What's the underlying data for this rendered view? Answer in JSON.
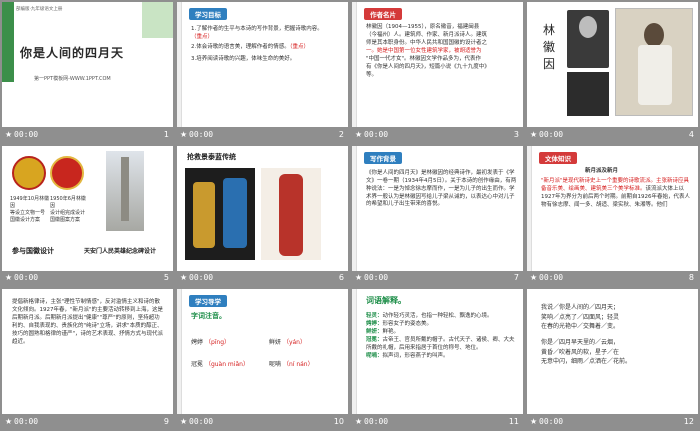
{
  "slides": [
    {
      "number": "1",
      "time": "00:00",
      "series_label": "部编版·九年级语文上册",
      "title": "你是人间的四月天",
      "footer": "第一PPT模板网-WWW.1PPT.COM"
    },
    {
      "number": "2",
      "time": "00:00",
      "heading": "学习目标",
      "items": [
        "1.了解作者的生平与本诗的写作背景，把握诗歌内容。",
        "2.体会诗歌的语言美，理解作者的情感。",
        "3.培养阅读诗歌的兴趣，体味生命的美好。"
      ],
      "highlight_1": "（重点）",
      "highlight_2": "（重点）"
    },
    {
      "number": "3",
      "time": "00:00",
      "heading": "作者名片",
      "lines": [
        "林徽因（1904—1955），原名徽音，福建闽县",
        "（今福州）人。建筑师、作家、新月派诗人。建筑",
        "师是其本职身份。中华人民共和国国徽的设计者之",
        "一。她是中国第一位女性建筑学家，被胡适誉为",
        "\"中国一代才女\"。林徽因文学作品多为，代表作",
        "有《你是人间的四月天》，短篇小说《九十九度中》",
        "等。"
      ]
    },
    {
      "number": "4",
      "time": "00:00",
      "name_chars": [
        "林",
        "徽",
        "因"
      ]
    },
    {
      "number": "5",
      "time": "00:00",
      "caption_left": "参与国徽设计",
      "caption_right": "天安门人民英雄纪念碑设计",
      "small_text_1": "1949年10月林徽因\n等设立文物一号\n国徽设计方案",
      "small_text_2": "1950年6月林徽因\n设计组完成设计\n国徽图案方案"
    },
    {
      "number": "6",
      "time": "00:00",
      "heading": "抢救景泰蓝传统"
    },
    {
      "number": "7",
      "time": "00:00",
      "heading": "写作背景",
      "text": "《你是人间的四月天》是林徽因的经典诗作，最初发表于《学文》一卷一期（1934年4月5日）。关于本诗的创作缘由，有两种说法：一是为悼念徐志摩而作，一是为儿子的出生而作。学术界一般认为是林徽因写给儿子梁从诫的，以表达心中对儿子的希望和儿子出生带来的喜悦。"
    },
    {
      "number": "8",
      "time": "00:00",
      "heading": "文体知识",
      "subheading": "新月派及新月",
      "text_red": "\"新月派\"是现代新诗史上一个重要的诗歌流派。主张新诗应具备音乐美、绘画美、建筑美三个美学标准。",
      "text_black": "该流派大体上以1927年为界分为前后两个时期。前期自1926年春始，代表人物有徐志摩、闻一多、胡适、梁实秋、朱湘等。他们"
    },
    {
      "number": "9",
      "time": "00:00",
      "text": "提倡新格律诗，主张\"理性节制情感\"，反对滥情主义和诗的散文化倾向。1927年春，\"新月派\"的主要活动转移到上海，这是后期新月派。后期新月派提出\"健康\"\"尊严\"的原则，坚持超功利的、自我表现的、贵族化的\"纯诗\"立场，讲求\"本质的醇正、技巧的圆熟和格律的谨严\"，诗的艺术表现、抒情方式与现代派趋近。"
    },
    {
      "number": "10",
      "time": "00:00",
      "heading": "学习导学",
      "sub": "字词注音。",
      "words": [
        {
          "w": "娉婷",
          "p": "（pīng",
          "p2": "）"
        },
        {
          "w": "鲜妍",
          "p": "（yán",
          "p2": "）"
        },
        {
          "w": "冠冕",
          "p": "（guàn miǎn",
          "p2": "）"
        },
        {
          "w": "呢喃",
          "p": "（ní nán",
          "p2": "）"
        }
      ]
    },
    {
      "number": "11",
      "time": "00:00",
      "heading": "词语解释。",
      "defs": [
        {
          "k": "轻灵：",
          "v": "动作轻巧灵活，也指一种轻松、飘逸的心境。"
        },
        {
          "k": "娉婷：",
          "v": "形容女子的姿态美。"
        },
        {
          "k": "鲜妍：",
          "v": "鲜艳。"
        },
        {
          "k": "冠冕：",
          "v": "古帝王、官员所戴的帽子。古代天子、诸侯、卿、大夫所戴的礼帽，后用来指居于首位的称号、地位。"
        },
        {
          "k": "呢喃：",
          "v": "拟声词，形容燕子的叫声。"
        }
      ]
    },
    {
      "number": "12",
      "time": "00:00",
      "lines": [
        "我说／你是人间的／四月天；",
        "笑响／点亮了／四面风；轻灵",
        "在春的光艳中／交舞着／变。",
        "",
        "你是／四月早天里的／云烟，",
        "黄昏／吹着风的软，星子／在",
        "无意中闪，细雨／点洒在／花前。"
      ]
    }
  ]
}
